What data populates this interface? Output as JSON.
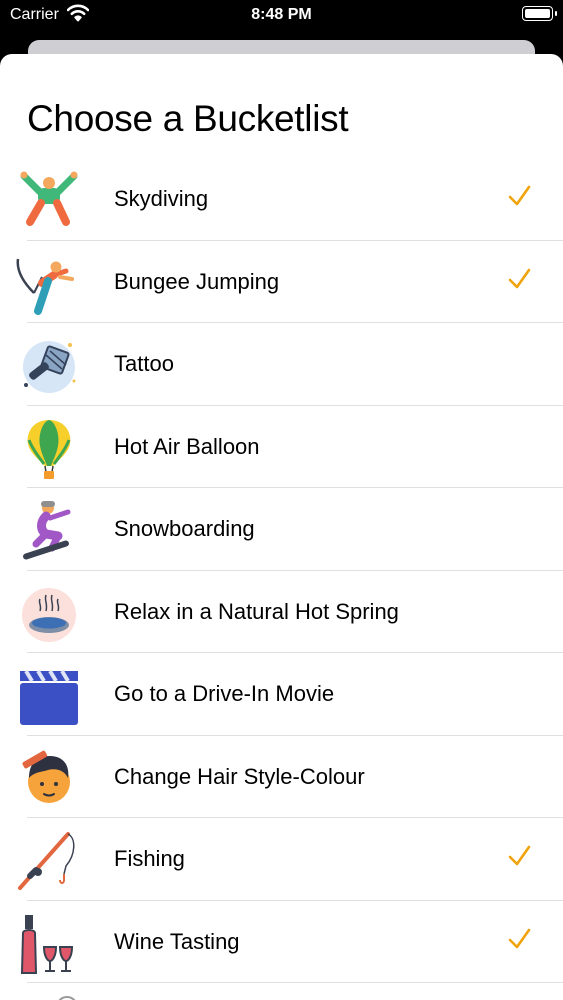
{
  "status_bar": {
    "carrier": "Carrier",
    "time": "8:48 PM"
  },
  "screen": {
    "title": "Choose a Bucketlist",
    "accent_color": "#f0a30a",
    "items": [
      {
        "label": "Skydiving",
        "icon": "skydiving-icon",
        "checked": true
      },
      {
        "label": "Bungee Jumping",
        "icon": "bungee-jumping-icon",
        "checked": true
      },
      {
        "label": "Tattoo",
        "icon": "tattoo-machine-icon",
        "checked": false
      },
      {
        "label": "Hot Air Balloon",
        "icon": "hot-air-balloon-icon",
        "checked": false
      },
      {
        "label": "Snowboarding",
        "icon": "snowboarding-icon",
        "checked": false
      },
      {
        "label": "Relax in a Natural Hot Spring",
        "icon": "hot-spring-icon",
        "checked": false
      },
      {
        "label": "Go to a Drive-In Movie",
        "icon": "clapperboard-icon",
        "checked": false
      },
      {
        "label": "Change Hair Style-Colour",
        "icon": "hair-comb-icon",
        "checked": false
      },
      {
        "label": "Fishing",
        "icon": "fishing-rod-icon",
        "checked": true
      },
      {
        "label": "Wine Tasting",
        "icon": "wine-bottle-glasses-icon",
        "checked": true
      }
    ]
  }
}
